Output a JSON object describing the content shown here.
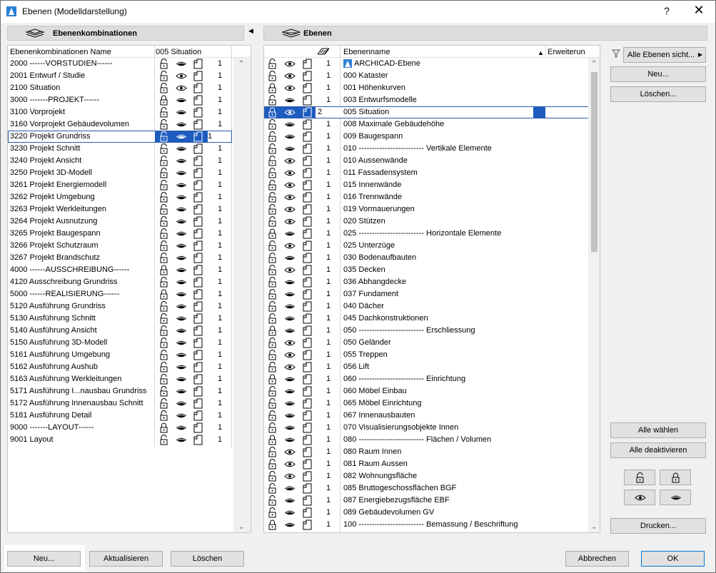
{
  "window": {
    "title": "Ebenen (Modelldarstellung)",
    "help_label": "?",
    "close_label": "✕"
  },
  "left": {
    "header": "Ebenenkombinationen",
    "col_name": "Ebenenkombinationen Name",
    "col_sit": "005 Situation",
    "rows": [
      {
        "name": "2000 ------VORSTUDIEN------",
        "lock": "open",
        "eye": "closed",
        "num": "1"
      },
      {
        "name": "2001 Entwurf / Studie",
        "lock": "open",
        "eye": "open",
        "num": "1"
      },
      {
        "name": "2100 Situation",
        "lock": "open",
        "eye": "open",
        "num": "1"
      },
      {
        "name": "3000 -------PROJEKT------",
        "lock": "closed",
        "eye": "closed",
        "num": "1"
      },
      {
        "name": "3100 Vorprojekt",
        "lock": "open",
        "eye": "closed",
        "num": "1"
      },
      {
        "name": "3160 Vorprojekt Gebäudevolumen",
        "lock": "open",
        "eye": "closed",
        "num": "1"
      },
      {
        "name": "3220 Projekt Grundriss",
        "lock": "open",
        "eye": "closed",
        "num": "1",
        "selected": true
      },
      {
        "name": "3230 Projekt Schnitt",
        "lock": "open",
        "eye": "closed",
        "num": "1"
      },
      {
        "name": "3240 Projekt Ansicht",
        "lock": "open",
        "eye": "closed",
        "num": "1"
      },
      {
        "name": "3250 Projekt 3D-Modell",
        "lock": "open",
        "eye": "closed",
        "num": "1"
      },
      {
        "name": "3261 Projekt Energiemodell",
        "lock": "open",
        "eye": "closed",
        "num": "1"
      },
      {
        "name": "3262 Projekt Umgebung",
        "lock": "open",
        "eye": "closed",
        "num": "1"
      },
      {
        "name": "3263 Projekt Werkleitungen",
        "lock": "open",
        "eye": "closed",
        "num": "1"
      },
      {
        "name": "3264 Projekt Ausnutzung",
        "lock": "open",
        "eye": "closed",
        "num": "1"
      },
      {
        "name": "3265 Projekt Baugespann",
        "lock": "open",
        "eye": "closed",
        "num": "1"
      },
      {
        "name": "3266 Projekt Schutzraum",
        "lock": "open",
        "eye": "closed",
        "num": "1"
      },
      {
        "name": "3267 Projekt Brandschutz",
        "lock": "open",
        "eye": "closed",
        "num": "1"
      },
      {
        "name": "4000 ------AUSSCHREIBUNG------",
        "lock": "closed",
        "eye": "closed",
        "num": "1"
      },
      {
        "name": "4120 Ausschreibung Grundriss",
        "lock": "open",
        "eye": "closed",
        "num": "1"
      },
      {
        "name": "5000 ------REALISIERUNG------",
        "lock": "closed",
        "eye": "closed",
        "num": "1"
      },
      {
        "name": "5120 Ausführung Grundriss",
        "lock": "open",
        "eye": "closed",
        "num": "1"
      },
      {
        "name": "5130 Ausführung Schnitt",
        "lock": "open",
        "eye": "closed",
        "num": "1"
      },
      {
        "name": "5140 Ausführung Ansicht",
        "lock": "open",
        "eye": "closed",
        "num": "1"
      },
      {
        "name": "5150 Ausführung 3D-Modell",
        "lock": "open",
        "eye": "closed",
        "num": "1"
      },
      {
        "name": "5161 Ausführung Umgebung",
        "lock": "open",
        "eye": "closed",
        "num": "1"
      },
      {
        "name": "5162 Ausführung Aushub",
        "lock": "open",
        "eye": "closed",
        "num": "1"
      },
      {
        "name": "5163 Ausführung Werkleitungen",
        "lock": "open",
        "eye": "closed",
        "num": "1"
      },
      {
        "name": "5171 Ausführung I...nausbau Grundriss",
        "lock": "open",
        "eye": "closed",
        "num": "1"
      },
      {
        "name": "5172 Ausführung Innenausbau Schnitt",
        "lock": "open",
        "eye": "closed",
        "num": "1"
      },
      {
        "name": "5181 Ausführung Detail",
        "lock": "open",
        "eye": "closed",
        "num": "1"
      },
      {
        "name": "9000 -------LAYOUT------",
        "lock": "closed",
        "eye": "closed",
        "num": "1"
      },
      {
        "name": "9001 Layout",
        "lock": "open",
        "eye": "closed",
        "num": "1"
      }
    ],
    "btn_new": "Neu...",
    "btn_update": "Aktualisieren",
    "btn_delete": "Löschen"
  },
  "right": {
    "header": "Ebenen",
    "col_name": "Ebenenname",
    "col_ext": "Erweiterun",
    "rows": [
      {
        "name": "ARCHICAD-Ebene",
        "lock": "open",
        "eye": "open",
        "num": "1",
        "archicad": true
      },
      {
        "name": "000 Kataster",
        "lock": "open",
        "eye": "open",
        "num": "1"
      },
      {
        "name": "001 Höhenkurven",
        "lock": "closed",
        "eye": "open",
        "num": "1"
      },
      {
        "name": "003 Entwurfsmodelle",
        "lock": "open",
        "eye": "closed",
        "num": "1"
      },
      {
        "name": "005 Situation",
        "lock": "closed",
        "eye": "open",
        "num": "2",
        "selected": true
      },
      {
        "name": "008 Maximale Gebäudehöhe",
        "lock": "open",
        "eye": "closed",
        "num": "1"
      },
      {
        "name": "009 Baugespann",
        "lock": "open",
        "eye": "closed",
        "num": "1"
      },
      {
        "name": "010 ------------------------- Vertikale Elemente",
        "lock": "open",
        "eye": "closed",
        "num": "1"
      },
      {
        "name": "010 Aussenwände",
        "lock": "open",
        "eye": "open",
        "num": "1"
      },
      {
        "name": "011 Fassadensystem",
        "lock": "open",
        "eye": "open",
        "num": "1"
      },
      {
        "name": "015 Innenwände",
        "lock": "open",
        "eye": "open",
        "num": "1"
      },
      {
        "name": "016 Trennwände",
        "lock": "open",
        "eye": "open",
        "num": "1"
      },
      {
        "name": "019 Vormauerungen",
        "lock": "open",
        "eye": "open",
        "num": "1"
      },
      {
        "name": "020 Stützen",
        "lock": "open",
        "eye": "open",
        "num": "1"
      },
      {
        "name": "025 ------------------------- Horizontale Elemente",
        "lock": "closed",
        "eye": "closed",
        "num": "1"
      },
      {
        "name": "025 Unterzüge",
        "lock": "open",
        "eye": "open",
        "num": "1"
      },
      {
        "name": "030 Bodenaufbauten",
        "lock": "open",
        "eye": "closed",
        "num": "1"
      },
      {
        "name": "035 Decken",
        "lock": "open",
        "eye": "open",
        "num": "1"
      },
      {
        "name": "036 Abhangdecke",
        "lock": "open",
        "eye": "closed",
        "num": "1"
      },
      {
        "name": "037 Fundament",
        "lock": "open",
        "eye": "closed",
        "num": "1"
      },
      {
        "name": "040 Dächer",
        "lock": "open",
        "eye": "closed",
        "num": "1"
      },
      {
        "name": "045 Dachkonstruktionen",
        "lock": "open",
        "eye": "closed",
        "num": "1"
      },
      {
        "name": "050 ------------------------- Erschliessung",
        "lock": "closed",
        "eye": "closed",
        "num": "1"
      },
      {
        "name": "050 Geländer",
        "lock": "open",
        "eye": "open",
        "num": "1"
      },
      {
        "name": "055 Treppen",
        "lock": "open",
        "eye": "open",
        "num": "1"
      },
      {
        "name": "056 Lift",
        "lock": "open",
        "eye": "open",
        "num": "1"
      },
      {
        "name": "060 ------------------------- Einrichtung",
        "lock": "closed",
        "eye": "closed",
        "num": "1"
      },
      {
        "name": "060 Möbel Einbau",
        "lock": "open",
        "eye": "closed",
        "num": "1"
      },
      {
        "name": "065 Möbel Einrichtung",
        "lock": "open",
        "eye": "closed",
        "num": "1"
      },
      {
        "name": "067 Innenausbauten",
        "lock": "open",
        "eye": "closed",
        "num": "1"
      },
      {
        "name": "070 Visualisierungsobjekte Innen",
        "lock": "open",
        "eye": "closed",
        "num": "1"
      },
      {
        "name": "080 ------------------------- Flächen / Volumen",
        "lock": "closed",
        "eye": "closed",
        "num": "1"
      },
      {
        "name": "080 Raum Innen",
        "lock": "open",
        "eye": "open",
        "num": "1"
      },
      {
        "name": "081 Raum Aussen",
        "lock": "open",
        "eye": "open",
        "num": "1"
      },
      {
        "name": "082 Wohnungsfläche",
        "lock": "open",
        "eye": "open",
        "num": "1"
      },
      {
        "name": "085 Bruttogeschossflächen BGF",
        "lock": "open",
        "eye": "closed",
        "num": "1"
      },
      {
        "name": "087 Energiebezugsfläche EBF",
        "lock": "open",
        "eye": "closed",
        "num": "1"
      },
      {
        "name": "089 Gebäudevolumen GV",
        "lock": "open",
        "eye": "closed",
        "num": "1"
      },
      {
        "name": "100 ------------------------- Bemassung / Beschriftung",
        "lock": "closed",
        "eye": "closed",
        "num": "1"
      }
    ]
  },
  "side": {
    "filter_label": "Alle Ebenen sicht...",
    "btn_new": "Neu...",
    "btn_delete": "Löschen...",
    "btn_select_all": "Alle wählen",
    "btn_deselect_all": "Alle deaktivieren",
    "btn_print": "Drucken..."
  },
  "footer": {
    "btn_cancel": "Abbrechen",
    "btn_ok": "OK"
  },
  "colors": {
    "selection": "#1e5cbf",
    "panel": "#f0f0f0"
  }
}
